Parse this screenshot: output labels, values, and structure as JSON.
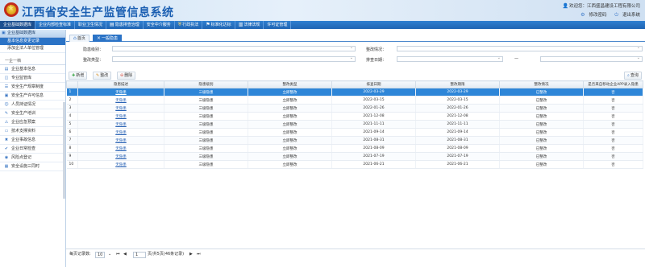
{
  "header": {
    "title": "江西省安全生产监管信息系统",
    "welcome": "欢迎您：江西盛昌建设工程有限公司",
    "change_password": "修改密码",
    "logout": "退出系统"
  },
  "nav": [
    "企业基础数据库",
    "企业内部检查标准",
    "职业卫生情况",
    "隐患排查治理",
    "安全中介服务",
    "行政执法",
    "标准化达标",
    "法律法规",
    "许可证管理"
  ],
  "sidebar": {
    "header": "企业基础数据库",
    "active": "基本信息变更记录",
    "sub": "添加企法人单位管理",
    "group": "一企一档",
    "items": [
      "企业基本信息",
      "专业监管库",
      "安全生产规章制度",
      "安全生产许可信息",
      "人员持证情况",
      "安全生产培训",
      "企业应急预案",
      "技术支撑资料",
      "企业事故信息",
      "企业日常检查",
      "风险点登记",
      "安全设施三同时"
    ]
  },
  "tabs": [
    "首页",
    "一般隐患"
  ],
  "filters": {
    "hazard_level": "隐患级别：",
    "rectify_status": "整改情况：",
    "rectify_type": "整改类型：",
    "report_date": "排查日期：",
    "range_sep": "—"
  },
  "toolbar": {
    "add": "新增",
    "edit": "整改",
    "delete": "删除",
    "query": "查询"
  },
  "table": {
    "columns": [
      "隐患描述",
      "隐患级别",
      "整改类型",
      "排查日期",
      "整改期限",
      "整改情况",
      "是否来自移动企业APP录入隐患"
    ],
    "rows": [
      {
        "n": "1",
        "desc": "无隐患",
        "level": "三级隐患",
        "type": "立即整改",
        "date": "2022-03-29",
        "deadline": "2022-03-29",
        "status": "已整改",
        "app": "否"
      },
      {
        "n": "2",
        "desc": "无隐患",
        "level": "三级隐患",
        "type": "立即整改",
        "date": "2022-03-15",
        "deadline": "2022-03-15",
        "status": "已整改",
        "app": "否"
      },
      {
        "n": "3",
        "desc": "无隐患",
        "level": "三级隐患",
        "type": "立即整改",
        "date": "2022-01-26",
        "deadline": "2022-01-26",
        "status": "已整改",
        "app": "否"
      },
      {
        "n": "4",
        "desc": "无隐患",
        "level": "三级隐患",
        "type": "立即整改",
        "date": "2021-12-08",
        "deadline": "2021-12-08",
        "status": "已整改",
        "app": "否"
      },
      {
        "n": "5",
        "desc": "无隐患",
        "level": "三级隐患",
        "type": "立即整改",
        "date": "2021-11-11",
        "deadline": "2021-11-11",
        "status": "已整改",
        "app": "否"
      },
      {
        "n": "6",
        "desc": "无隐患",
        "level": "三级隐患",
        "type": "立即整改",
        "date": "2021-09-14",
        "deadline": "2021-09-14",
        "status": "已整改",
        "app": "否"
      },
      {
        "n": "7",
        "desc": "无隐患",
        "level": "三级隐患",
        "type": "立即整改",
        "date": "2021-08-31",
        "deadline": "2021-08-31",
        "status": "已整改",
        "app": "否"
      },
      {
        "n": "8",
        "desc": "无隐患",
        "level": "三级隐患",
        "type": "立即整改",
        "date": "2021-08-09",
        "deadline": "2021-08-09",
        "status": "已整改",
        "app": "否"
      },
      {
        "n": "9",
        "desc": "无隐患",
        "level": "三级隐患",
        "type": "立即整改",
        "date": "2021-07-19",
        "deadline": "2021-07-19",
        "status": "已整改",
        "app": "否"
      },
      {
        "n": "10",
        "desc": "无隐患",
        "level": "三级隐患",
        "type": "立即整改",
        "date": "2021-06-21",
        "deadline": "2021-06-21",
        "status": "已整改",
        "app": "否"
      }
    ]
  },
  "pager": {
    "per_page_label": "每页记录数:",
    "per_page": "10",
    "page": "1",
    "summary": "页/共5页(46条记录)"
  }
}
